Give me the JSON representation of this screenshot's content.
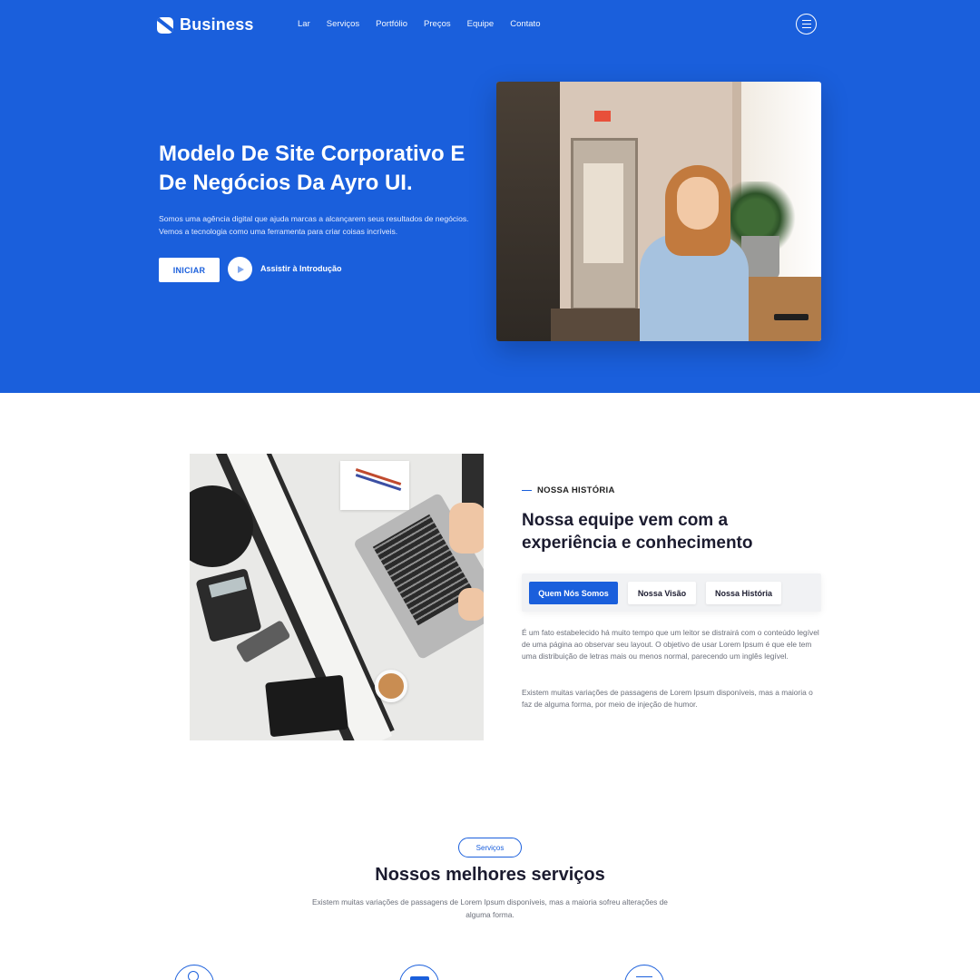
{
  "brand": {
    "name": "Business"
  },
  "nav": {
    "items": [
      "Lar",
      "Serviços",
      "Portfólio",
      "Preços",
      "Equipe",
      "Contato"
    ]
  },
  "hero": {
    "title": "Modelo De Site Corporativo E De Negócios Da Ayro UI.",
    "description": "Somos uma agência digital que ajuda marcas a alcançarem seus resultados de negócios. Vemos a tecnologia como uma ferramenta para criar coisas incríveis.",
    "primary_button": "INICIAR",
    "video_label": "Assistir à Introdução"
  },
  "about": {
    "eyebrow": "NOSSA HISTÓRIA",
    "title": "Nossa equipe vem com a experiência e conhecimento",
    "tabs": [
      "Quem Nós Somos",
      "Nossa Visão",
      "Nossa História"
    ],
    "active_tab": "Quem Nós Somos",
    "paragraph_1": "É um fato estabelecido há muito tempo que um leitor se distrairá com o conteúdo legível de uma página ao observar seu layout. O objetivo de usar Lorem Ipsum é que ele tem uma distribuição de letras mais ou menos normal, parecendo um inglês legível.",
    "paragraph_2": "Existem muitas variações de passagens de Lorem Ipsum disponíveis, mas a maioria o faz de alguma forma, por meio de injeção de humor."
  },
  "services": {
    "badge": "Serviços",
    "title": "Nossos melhores serviços",
    "description": "Existem muitas variações de passagens de Lorem Ipsum disponíveis, mas a maioria sofreu alterações de alguma forma."
  },
  "colors": {
    "accent": "#1a5fdc",
    "text_dark": "#1b1b2f",
    "text_muted": "#6b6f7a"
  }
}
